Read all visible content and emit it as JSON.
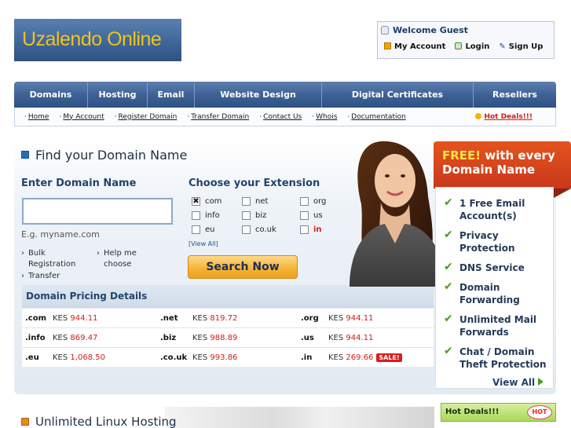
{
  "logo": {
    "text": "Uzalendo Online"
  },
  "welcome": {
    "title": "Welcome Guest",
    "my_account": "My Account",
    "login": "Login",
    "sign_up": "Sign Up"
  },
  "main_nav": [
    {
      "label": "Domains"
    },
    {
      "label": "Hosting"
    },
    {
      "label": "Email"
    },
    {
      "label": "Website Design"
    },
    {
      "label": "Digital Certificates"
    },
    {
      "label": "Resellers"
    }
  ],
  "sub_nav": [
    {
      "label": "Home"
    },
    {
      "label": "My Account"
    },
    {
      "label": "Register Domain"
    },
    {
      "label": "Transfer Domain"
    },
    {
      "label": "Contact Us"
    },
    {
      "label": "Whois"
    },
    {
      "label": "Documentation"
    }
  ],
  "hot_deals_link": "Hot Deals!!!",
  "domain_search": {
    "title": "Find your Domain Name",
    "enter_label": "Enter Domain Name",
    "input_value": "",
    "example": "E.g. myname.com",
    "links": {
      "bulk_1": "Bulk",
      "bulk_2": "Registration",
      "help_1": "Help me",
      "help_2": "choose",
      "transfer": "Transfer"
    },
    "choose_label": "Choose your Extension",
    "extensions": [
      {
        "label": "com",
        "checked": "✖"
      },
      {
        "label": "net",
        "checked": ""
      },
      {
        "label": "org",
        "checked": ""
      },
      {
        "label": "info",
        "checked": ""
      },
      {
        "label": "biz",
        "checked": ""
      },
      {
        "label": "us",
        "checked": ""
      },
      {
        "label": "eu",
        "checked": ""
      },
      {
        "label": "co.uk",
        "checked": ""
      },
      {
        "label": "in",
        "checked": ""
      }
    ],
    "view_all": "[View All]",
    "search_button": "Search Now"
  },
  "pricing": {
    "title": "Domain Pricing Details",
    "currency": "KES",
    "rows": [
      [
        {
          "tld": ".com",
          "price": "944.11"
        },
        {
          "tld": ".net",
          "price": "819.72"
        },
        {
          "tld": ".org",
          "price": "944.11"
        }
      ],
      [
        {
          "tld": ".info",
          "price": "869.47"
        },
        {
          "tld": ".biz",
          "price": "988.89"
        },
        {
          "tld": ".us",
          "price": "944.11"
        }
      ],
      [
        {
          "tld": ".eu",
          "price": "1,068.50"
        },
        {
          "tld": ".co.uk",
          "price": "993.86"
        },
        {
          "tld": ".in",
          "price": "269.66"
        }
      ]
    ],
    "sale_badge": "SALE!"
  },
  "free_box": {
    "free_word": "FREE!",
    "line1_rest": " with every",
    "line2": "Domain Name",
    "features": [
      {
        "line1": "1 Free Email",
        "line2": "Account(s)"
      },
      {
        "line1": "Privacy",
        "line2": "Protection"
      },
      {
        "line1": "DNS Service",
        "line2": ""
      },
      {
        "line1": "Domain",
        "line2": "Forwarding"
      },
      {
        "line1": "Unlimited Mail",
        "line2": "Forwards"
      },
      {
        "line1": "Chat / Domain",
        "line2": "Theft Protection"
      }
    ],
    "view_all": "View All"
  },
  "bottom": {
    "linux_title": "Unlimited Linux Hosting",
    "hot_deals": "Hot Deals!!!",
    "hot_badge": "HOT"
  },
  "colors": {
    "nav_blue": "#3f6296",
    "accent_orange": "#e4541f",
    "button_orange": "#f6b53a",
    "price_red": "#d21c1c",
    "check_green": "#4b9b1d"
  }
}
